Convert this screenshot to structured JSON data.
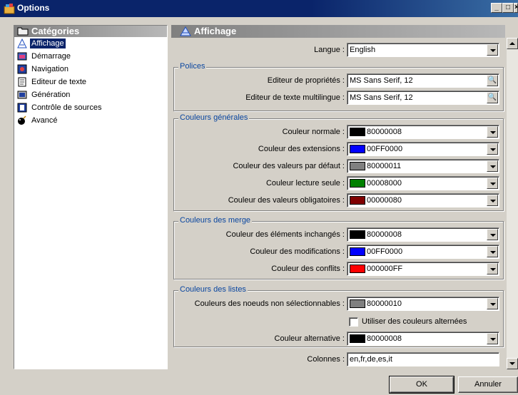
{
  "window": {
    "title": "Options"
  },
  "window_buttons": {
    "minimize": "_",
    "maximize": "□",
    "close": "×"
  },
  "categories": {
    "header": "Catégories",
    "items": [
      {
        "label": "Affichage",
        "icon": "display-icon",
        "selected": true
      },
      {
        "label": "Démarrage",
        "icon": "startup-icon"
      },
      {
        "label": "Navigation",
        "icon": "navigation-icon"
      },
      {
        "label": "Editeur de texte",
        "icon": "text-editor-icon"
      },
      {
        "label": "Génération",
        "icon": "generation-icon"
      },
      {
        "label": "Contrôle de sources",
        "icon": "source-control-icon"
      },
      {
        "label": "Avancé",
        "icon": "bomb-icon"
      }
    ]
  },
  "panel": {
    "header": "Affichage"
  },
  "langue": {
    "label": "Langue :",
    "value": "English"
  },
  "polices": {
    "title": "Polices",
    "rows": [
      {
        "label": "Editeur de propriétés :",
        "value": "MS Sans Serif, 12"
      },
      {
        "label": "Editeur de texte multilingue :",
        "value": "MS Sans Serif, 12"
      }
    ]
  },
  "couleurs_generales": {
    "title": "Couleurs générales",
    "rows": [
      {
        "label": "Couleur normale :",
        "value": "80000008",
        "swatch": "#000000"
      },
      {
        "label": "Couleur des extensions :",
        "value": "00FF0000",
        "swatch": "#0000ff"
      },
      {
        "label": "Couleur des valeurs par défaut :",
        "value": "80000011",
        "swatch": "#808080"
      },
      {
        "label": "Couleur lecture seule :",
        "value": "00008000",
        "swatch": "#008000"
      },
      {
        "label": "Couleur des valeurs obligatoires :",
        "value": "00000080",
        "swatch": "#800000"
      }
    ]
  },
  "couleurs_merge": {
    "title": "Couleurs des merge",
    "rows": [
      {
        "label": "Couleur des éléments inchangés :",
        "value": "80000008",
        "swatch": "#000000"
      },
      {
        "label": "Couleur des modifications :",
        "value": "00FF0000",
        "swatch": "#0000ff"
      },
      {
        "label": "Couleur des conflits :",
        "value": "000000FF",
        "swatch": "#ff0000"
      }
    ]
  },
  "couleurs_listes": {
    "title": "Couleurs des listes",
    "non_selectable": {
      "label": "Couleurs des noeuds non sélectionnables :",
      "value": "80000010",
      "swatch": "#808080"
    },
    "alternate_checkbox": {
      "label": "Utiliser des couleurs alternées",
      "checked": false
    },
    "alternative": {
      "label": "Couleur alternative :",
      "value": "80000008",
      "swatch": "#000000"
    }
  },
  "colonnes": {
    "label": "Colonnes :",
    "value": "en,fr,de,es,it"
  },
  "buttons": {
    "ok": "OK",
    "cancel": "Annuler"
  }
}
